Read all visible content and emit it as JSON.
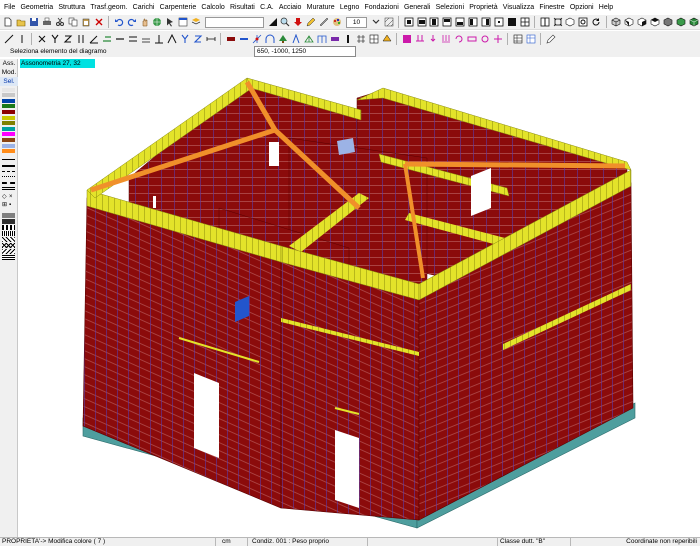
{
  "menu": [
    "File",
    "Geometria",
    "Struttura",
    "Trasf.geom.",
    "Carichi",
    "Carpenterie",
    "Calcolo",
    "Risultati",
    "C.A.",
    "Acciaio",
    "Murature",
    "Legno",
    "Fondazioni",
    "Generali",
    "Selezioni",
    "Proprietà",
    "Visualizza",
    "Finestre",
    "Opzioni",
    "Help"
  ],
  "toolbar": {
    "text_field_value": "",
    "layer_value": "10"
  },
  "prompt": {
    "text": "Seleziona  elemento del diagramo",
    "input_value": "650, -1000, 1250"
  },
  "left_panel": {
    "tabs": [
      "Ass.",
      "Mod.",
      "Sel."
    ],
    "swatches": [
      "#e6e6e6",
      "#c8c8c8",
      "#0044aa",
      "#1a7a1a",
      "#8b0000",
      "#c8c800",
      "#808000",
      "#00a0a0",
      "#ff00ff",
      "#8b4513",
      "#9cb3e6",
      "#ff8c1a"
    ],
    "symbols": [
      "◇",
      "×",
      "⊞",
      "▪"
    ]
  },
  "view": {
    "label": "Assonometria   27, 32",
    "colors": {
      "wall": "#8b0b0b",
      "beam": "#e3e32a",
      "foundation": "#4e9e9e",
      "rafter": "#f0902a",
      "block": "#2255cc",
      "opening": "#ffffff"
    }
  },
  "status": {
    "mode": "PROPRIETA'-> Modifica colore ( 7 )",
    "unit": "cm",
    "condition": "Condiz. 001 : Peso proprio",
    "class": "Classe dutt. \"B\"",
    "coords": "Coordinate non reperibili"
  }
}
